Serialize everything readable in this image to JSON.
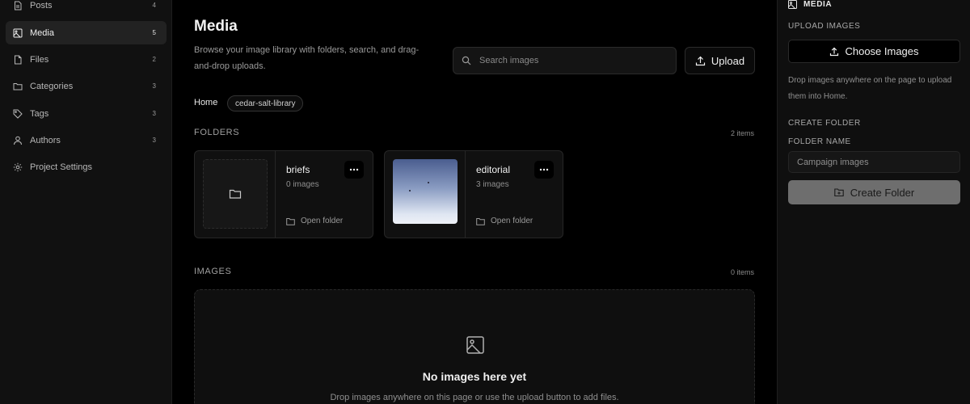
{
  "sidebar": {
    "items": [
      {
        "label": "Posts",
        "count": "4",
        "icon": "document-icon",
        "active": false
      },
      {
        "label": "Media",
        "count": "5",
        "icon": "image-icon",
        "active": true
      },
      {
        "label": "Files",
        "count": "2",
        "icon": "file-icon",
        "active": false
      },
      {
        "label": "Categories",
        "count": "3",
        "icon": "folder-icon",
        "active": false
      },
      {
        "label": "Tags",
        "count": "3",
        "icon": "tag-icon",
        "active": false
      },
      {
        "label": "Authors",
        "count": "3",
        "icon": "user-icon",
        "active": false
      },
      {
        "label": "Project Settings",
        "count": "",
        "icon": "gear-icon",
        "active": false
      }
    ]
  },
  "header": {
    "title": "Media",
    "subtitle": "Browse your image library with folders, search, and drag-and-drop uploads."
  },
  "search": {
    "placeholder": "Search images",
    "value": ""
  },
  "upload_button": {
    "label": "Upload"
  },
  "breadcrumb": {
    "home": "Home",
    "current": "cedar-salt-library"
  },
  "folders_section": {
    "label": "FOLDERS",
    "count": "2 items",
    "folders": [
      {
        "name": "briefs",
        "meta": "0 images",
        "open_label": "Open folder",
        "thumbnail": "empty"
      },
      {
        "name": "editorial",
        "meta": "3 images",
        "open_label": "Open folder",
        "thumbnail": "image"
      }
    ]
  },
  "images_section": {
    "label": "IMAGES",
    "count": "0 items",
    "empty_title": "No images here yet",
    "empty_desc": "Drop images anywhere on this page or use the upload button to add files."
  },
  "panel": {
    "title": "MEDIA",
    "upload_label": "UPLOAD IMAGES",
    "choose_button": "Choose Images",
    "note": "Drop images anywhere on the page to upload them into Home.",
    "create_label": "CREATE FOLDER",
    "folder_name_label": "FOLDER NAME",
    "folder_name_placeholder": "Campaign images",
    "create_button": "Create Folder"
  },
  "colors": {
    "background": "#000000",
    "sidebar_bg": "#111111",
    "active_item_bg": "#222222",
    "create_button_bg": "#6e6e6e"
  }
}
